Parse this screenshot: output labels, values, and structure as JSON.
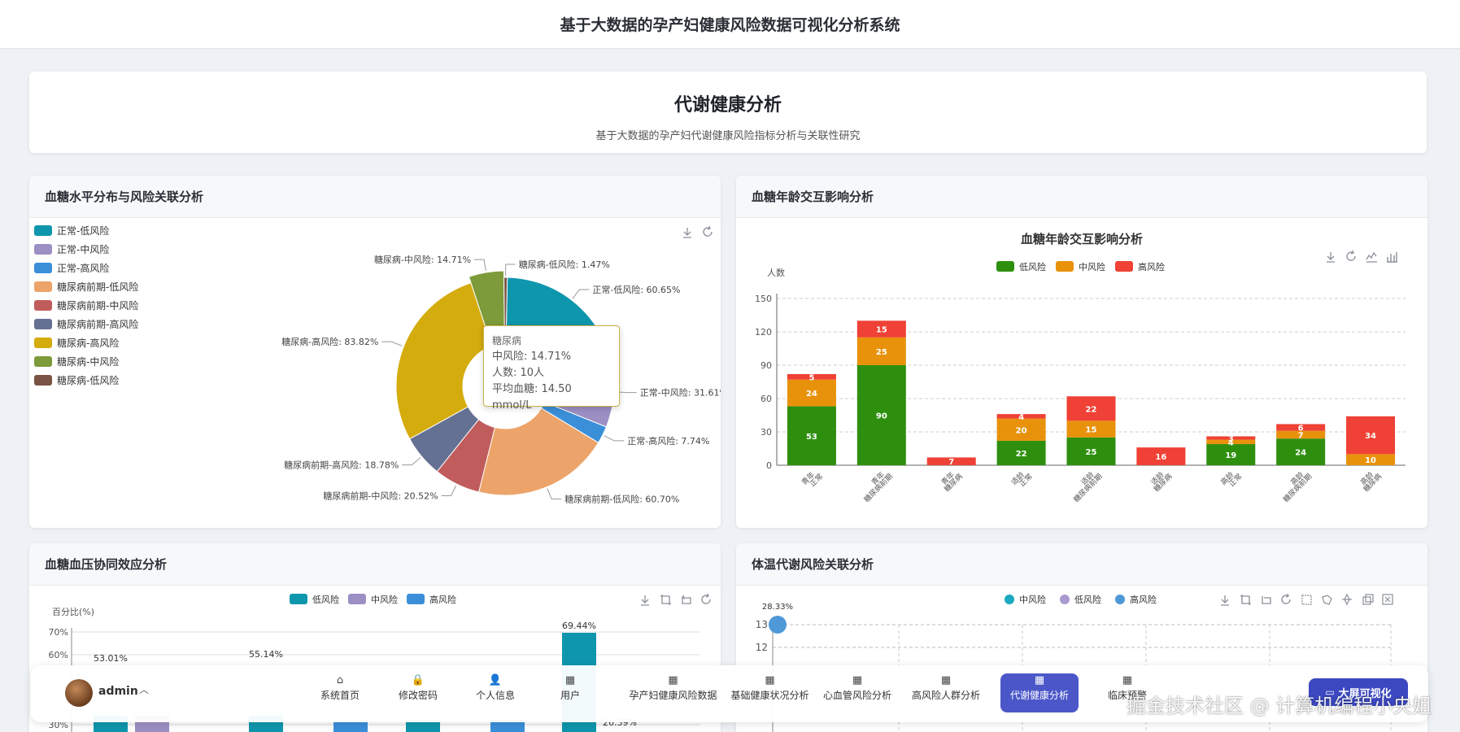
{
  "app": {
    "title": "基于大数据的孕产妇健康风险数据可视化分析系统"
  },
  "header": {
    "title": "代谢健康分析",
    "subtitle": "基于大数据的孕产妇代谢健康风险指标分析与关联性研究"
  },
  "panels": {
    "glucose_distribution": {
      "title": "血糖水平分布与风险关联分析"
    },
    "glucose_age": {
      "title": "血糖年龄交互影响分析"
    },
    "glucose_bp": {
      "title": "血糖血压协同效应分析"
    },
    "temp_metabolic": {
      "title": "体温代谢风险关联分析"
    }
  },
  "colors": {
    "teal": "#0e96ad",
    "purple": "#9b8fc4",
    "blue": "#3b8fd9",
    "salmon": "#eca46a",
    "rose": "#c15c5d",
    "slate": "#657193",
    "gold": "#d4ac0d",
    "olive": "#7d9b3a",
    "brown": "#7a5345",
    "green": "#2e8f0f",
    "orange": "#e8920c",
    "red": "#ef4135",
    "active_nav": "#4b57c8"
  },
  "tooltip": {
    "title": "糖尿病",
    "line1": "中风险: 14.71%",
    "line2": "人数: 10人",
    "line3": "平均血糖: 14.50 mmol/L"
  },
  "chart_data": [
    {
      "type": "pie",
      "legend": [
        "正常-低风险",
        "正常-中风险",
        "正常-高风险",
        "糖尿病前期-低风险",
        "糖尿病前期-中风险",
        "糖尿病前期-高风险",
        "糖尿病-高风险",
        "糖尿病-中风险",
        "糖尿病-低风险"
      ],
      "slices": [
        {
          "label": "正常-低风险: 60.65%",
          "value": 60.65,
          "color": "#0e96ad"
        },
        {
          "label": "正常-中风险: 31.61%",
          "value": 31.61,
          "color": "#9b8fc4"
        },
        {
          "label": "正常-高风险: 7.74%",
          "value": 7.74,
          "color": "#3b8fd9"
        },
        {
          "label": "糖尿病前期-低风险: 60.70%",
          "value": 60.7,
          "color": "#eca46a"
        },
        {
          "label": "糖尿病前期-中风险: 20.52%",
          "value": 20.52,
          "color": "#c15c5d"
        },
        {
          "label": "糖尿病前期-高风险: 18.78%",
          "value": 18.78,
          "color": "#657193"
        },
        {
          "label": "糖尿病-高风险: 83.82%",
          "value": 83.82,
          "color": "#d4ac0d"
        },
        {
          "label": "糖尿病-中风险: 14.71%",
          "value": 14.71,
          "color": "#7d9b3a"
        },
        {
          "label": "糖尿病-低风险: 1.47%",
          "value": 1.47,
          "color": "#7a5345"
        }
      ]
    },
    {
      "type": "bar",
      "title": "血糖年龄交互影响分析",
      "ylabel": "人数",
      "ylim": [
        0,
        150
      ],
      "yticks": [
        0,
        30,
        60,
        90,
        120,
        150
      ],
      "categories": [
        "青年\n正常",
        "青年\n糖尿病前期",
        "青年\n糖尿病",
        "适龄\n正常",
        "适龄\n糖尿病前期",
        "适龄\n糖尿病",
        "高龄\n正常",
        "高龄\n糖尿病前期",
        "高龄\n糖尿病"
      ],
      "series": [
        {
          "name": "低风险",
          "color": "#2e8f0f",
          "values": [
            53,
            90,
            0,
            22,
            25,
            0,
            19,
            24,
            0
          ]
        },
        {
          "name": "中风险",
          "color": "#e8920c",
          "values": [
            24,
            25,
            0,
            20,
            15,
            0,
            4,
            7,
            10
          ]
        },
        {
          "name": "高风险",
          "color": "#ef4135",
          "values": [
            5,
            15,
            7,
            4,
            22,
            16,
            3,
            6,
            34
          ]
        }
      ]
    },
    {
      "type": "bar",
      "ylabel": "百分比(%)",
      "yticks": [
        "70%",
        "60%",
        "30%"
      ],
      "series": [
        {
          "name": "低风险",
          "color": "#0e96ad"
        },
        {
          "name": "中风险",
          "color": "#9b8fc4"
        },
        {
          "name": "高风险",
          "color": "#3b8fd9"
        }
      ],
      "visible_labels": [
        "53.01%",
        "55.14%",
        "69.44%",
        "26.39%"
      ]
    },
    {
      "type": "scatter",
      "yticks": [
        "13",
        "12"
      ],
      "series": [
        {
          "name": "中风险",
          "color": "#1ba9c0"
        },
        {
          "name": "低风险",
          "color": "#a99ad0"
        },
        {
          "name": "高风险",
          "color": "#4e98d8"
        }
      ],
      "visible_labels": [
        "28.33%"
      ]
    }
  ],
  "nav": {
    "user": "admin",
    "items": [
      {
        "label": "系统首页",
        "icon": "home-icon",
        "glyph": "⌂"
      },
      {
        "label": "修改密码",
        "icon": "lock-icon",
        "glyph": "🔒"
      },
      {
        "label": "个人信息",
        "icon": "user-icon",
        "glyph": "👤"
      },
      {
        "label": "用户",
        "icon": "grid-icon",
        "glyph": "▦"
      },
      {
        "label": "孕产妇健康风险数据",
        "icon": "grid-icon",
        "glyph": "▦"
      },
      {
        "label": "基础健康状况分析",
        "icon": "grid-icon",
        "glyph": "▦"
      },
      {
        "label": "心血管风险分析",
        "icon": "grid-icon",
        "glyph": "▦"
      },
      {
        "label": "高风险人群分析",
        "icon": "grid-icon",
        "glyph": "▦"
      },
      {
        "label": "代谢健康分析",
        "icon": "grid-icon",
        "glyph": "▦"
      },
      {
        "label": "临床预警",
        "icon": "grid-icon",
        "glyph": "▦"
      }
    ],
    "bigscreen": "大屏可视化"
  },
  "watermark": "掘金技术社区 @ 计算机编程小央姐"
}
